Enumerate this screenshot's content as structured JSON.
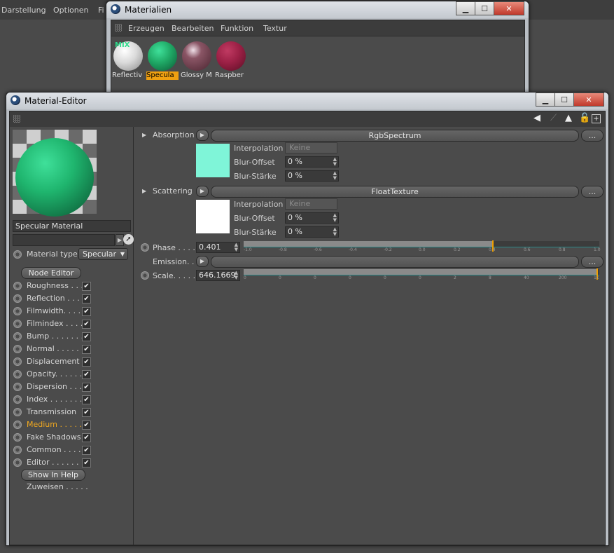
{
  "app": {
    "menu": [
      "Darstellung",
      "Optionen",
      "Fi"
    ]
  },
  "materials_window": {
    "title": "Materialien",
    "menu": [
      "Erzeugen",
      "Bearbeiten",
      "Funktion",
      "Textur"
    ],
    "mix_tag": "MIX",
    "items": [
      {
        "label": "Reflectiv",
        "color": "#d9d9d9"
      },
      {
        "label": "Specula",
        "color": "#1fa865",
        "selected": true
      },
      {
        "label": "Glossy M",
        "color": "#6b3d4c"
      },
      {
        "label": "Raspber",
        "color": "#9b2045"
      }
    ]
  },
  "editor_window": {
    "title": "Material-Editor",
    "material_name": "Specular Material",
    "material_type_label": "Material type",
    "material_type_value": "Specular",
    "node_editor_label": "Node Editor",
    "channels": [
      {
        "label": "Roughness . . .",
        "checked": "✔"
      },
      {
        "label": "Reflection . . .",
        "checked": "✔"
      },
      {
        "label": "Filmwidth. . . .",
        "checked": "✔"
      },
      {
        "label": "Filmindex . . . .",
        "checked": "✔"
      },
      {
        "label": "Bump . . . . . . .",
        "checked": "✔"
      },
      {
        "label": "Normal . . . . . .",
        "checked": "✔"
      },
      {
        "label": "Displacement",
        "checked": "✔"
      },
      {
        "label": "Opacity. . . . . .",
        "checked": "✔"
      },
      {
        "label": "Dispersion . . .",
        "checked": "✔"
      },
      {
        "label": "Index . . . . . . .",
        "checked": "✔"
      },
      {
        "label": "Transmission",
        "checked": "✔"
      },
      {
        "label": "Medium . . . . .",
        "checked": "✔",
        "active": true
      },
      {
        "label": "Fake Shadows",
        "checked": "✔"
      },
      {
        "label": "Common . . . .",
        "checked": "✔"
      },
      {
        "label": "Editor . . . . . . .",
        "checked": "✔"
      }
    ],
    "show_in_help_label": "Show In Help",
    "assign_label": "Zuweisen . . . . .",
    "absorption": {
      "label": "Absorption",
      "texture": "RgbSpectrum",
      "more": "...",
      "swatch": "#7ff5d8",
      "interpolation_label": "Interpolation",
      "interpolation_value": "Keine",
      "blur_offset_label": "Blur-Offset",
      "blur_offset_value": "0 %",
      "blur_strength_label": "Blur-Stärke",
      "blur_strength_value": "0 %"
    },
    "scattering": {
      "label": "Scattering",
      "texture": "FloatTexture",
      "more": "...",
      "swatch": "#ffffff",
      "interpolation_label": "Interpolation",
      "interpolation_value": "Keine",
      "blur_offset_label": "Blur-Offset",
      "blur_offset_value": "0 %",
      "blur_strength_label": "Blur-Stärke",
      "blur_strength_value": "0 %"
    },
    "phase": {
      "label": "Phase . . . .",
      "value": "0.401",
      "slider_fraction": 0.7,
      "ticks": [
        "-1.0",
        "-0.8",
        "-0.6",
        "-0.4",
        "-0.2",
        "0.0",
        "0.2",
        "0.4",
        "0.6",
        "0.8",
        "1.0"
      ]
    },
    "emission": {
      "label": "Emission. .",
      "more": "..."
    },
    "scale": {
      "label": "Scale. . . . .",
      "value": "646.1669",
      "slider_fraction": 0.995,
      "ticks": [
        "0",
        "0",
        "0",
        "0",
        "0",
        "0",
        "2",
        "8",
        "40",
        "200",
        "1k"
      ]
    }
  }
}
